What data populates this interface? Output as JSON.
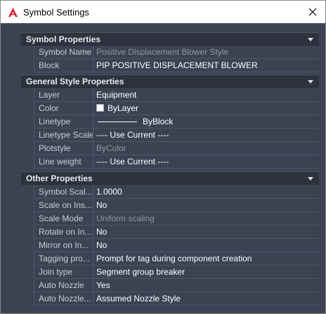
{
  "window": {
    "title": "Symbol Settings",
    "app_icon": "autocad-a-icon",
    "close_icon": "close-icon"
  },
  "sections": {
    "symbol": {
      "title": "Symbol Properties",
      "rows": [
        {
          "label": "Symbol Name",
          "value": "Positive Displacement Blower Style"
        },
        {
          "label": "Block",
          "value": "PIP POSITIVE DISPLACEMENT BLOWER"
        }
      ]
    },
    "general": {
      "title": "General Style Properties",
      "rows": [
        {
          "label": "Layer",
          "value": "Equipment"
        },
        {
          "label": "Color",
          "value": "ByLayer"
        },
        {
          "label": "Linetype",
          "value": "ByBlock"
        },
        {
          "label": "Linetype Scale",
          "value": "---- Use Current ----"
        },
        {
          "label": "Plotstyle",
          "value": "ByColor"
        },
        {
          "label": "Line weight",
          "value": "---- Use Current ----"
        }
      ]
    },
    "other": {
      "title": "Other Properties",
      "rows": [
        {
          "label": "Symbol Scal...",
          "value": "1.0000"
        },
        {
          "label": "Scale on Ins...",
          "value": "No"
        },
        {
          "label": "Scale Mode",
          "value": "Uniform scaling"
        },
        {
          "label": "Rotate on In...",
          "value": "No"
        },
        {
          "label": "Mirror on In...",
          "value": "No"
        },
        {
          "label": "Tagging pro...",
          "value": "Prompt for tag during component creation"
        },
        {
          "label": "Join type",
          "value": "Segment group breaker"
        },
        {
          "label": "Auto Nozzle",
          "value": "Yes"
        },
        {
          "label": "Auto Nozzle...",
          "value": "Assumed Nozzle Style"
        }
      ]
    }
  },
  "colors": {
    "panel_bg": "#3b4353",
    "header_bg": "#2d323d",
    "dim_text": "#8f97a5",
    "accent_red": "#d0262d"
  }
}
